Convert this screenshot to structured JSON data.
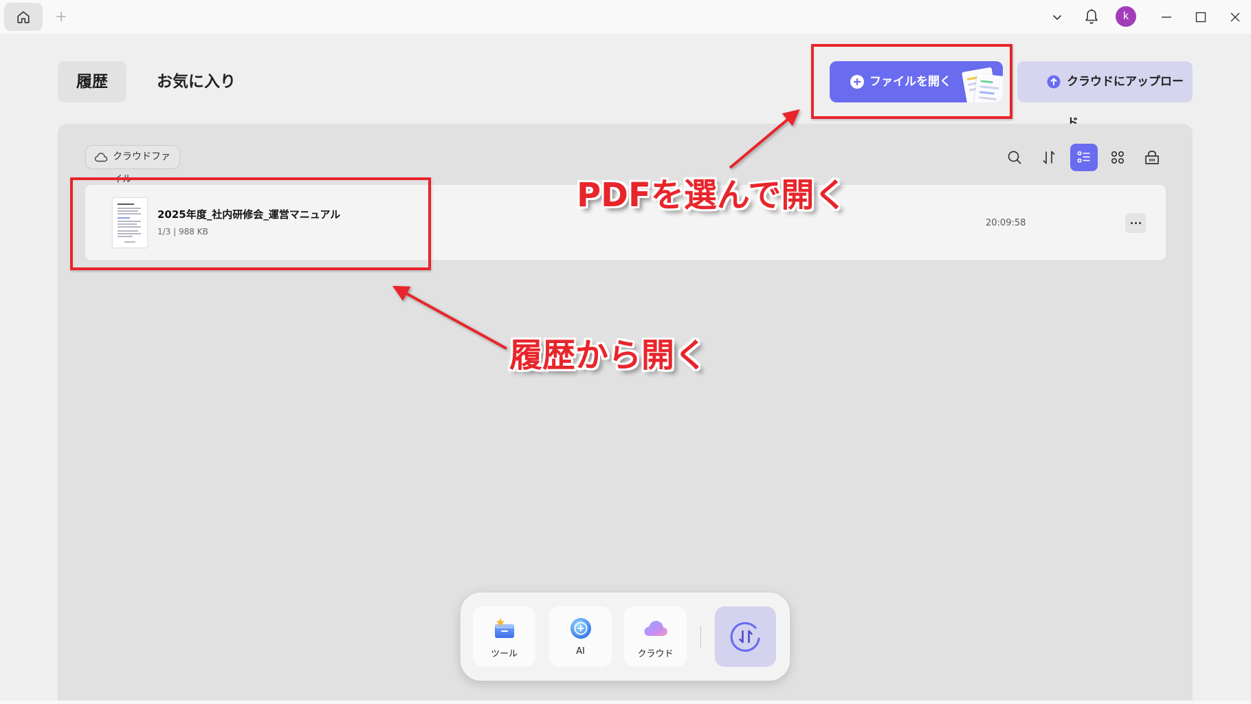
{
  "titlebar": {
    "avatar_letter": "k",
    "icons": [
      "home-icon",
      "plus-icon",
      "chevron-down-icon",
      "bell-icon",
      "minimize-icon",
      "maximize-icon",
      "close-icon"
    ]
  },
  "tabs": [
    {
      "label": "履歴",
      "active": true
    },
    {
      "label": "お気に入り",
      "active": false
    }
  ],
  "actions": {
    "open_file": "ファイルを開く",
    "upload": "クラウドにアップロード"
  },
  "cloud_chip": {
    "label": "クラウドファイル",
    "icon": "cloud-icon"
  },
  "toolbar": {
    "icons": [
      "search-icon",
      "sort-icon",
      "list-view-icon",
      "grid-view-icon",
      "basket-icon"
    ],
    "active_view": "list"
  },
  "files": [
    {
      "name": "2025年度_社内研修会_運営マニュアル",
      "meta": "1/3 | 988 KB",
      "time": "20:09:58"
    }
  ],
  "annotations": {
    "open_pdf": "PDFを選んで開く",
    "from_history": "履歴から開く"
  },
  "dock": {
    "items": [
      {
        "label": "ツール",
        "icon": "tools-icon"
      },
      {
        "label": "AI",
        "icon": "ai-icon"
      },
      {
        "label": "クラウド",
        "icon": "cloud-icon"
      }
    ],
    "action_icon": "convert-icon"
  },
  "colors": {
    "accent": "#6a6cf0",
    "upload_bg": "#d5d5ef",
    "annotation_red": "#e8252b",
    "avatar": "#a23db9"
  }
}
